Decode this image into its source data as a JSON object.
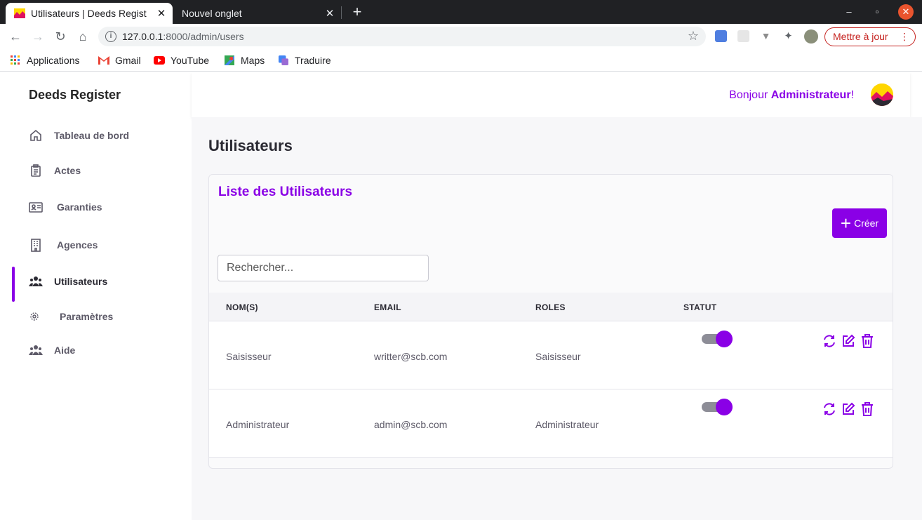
{
  "browser": {
    "tabs": [
      {
        "title": "Utilisateurs | Deeds Regist",
        "active": true
      },
      {
        "title": "Nouvel onglet",
        "active": false
      }
    ],
    "url_host": "127.0.0.1",
    "url_rest": ":8000/admin/users",
    "update_label": "Mettre à jour",
    "bookmarks": [
      "Applications",
      "Gmail",
      "YouTube",
      "Maps",
      "Traduire"
    ]
  },
  "sidebar": {
    "brand": "Deeds Register",
    "items": [
      {
        "label": "Tableau de bord",
        "icon": "home-icon"
      },
      {
        "label": "Actes",
        "icon": "clipboard-icon"
      },
      {
        "label": "Garanties",
        "icon": "id-card-icon"
      },
      {
        "label": "Agences",
        "icon": "building-icon"
      },
      {
        "label": "Utilisateurs",
        "icon": "users-icon",
        "active": true
      },
      {
        "label": "Paramètres",
        "icon": "gear-icon"
      },
      {
        "label": "Aide",
        "icon": "users-icon"
      }
    ]
  },
  "header": {
    "greeting_prefix": "Bonjour ",
    "greeting_name": "Administrateur",
    "greeting_suffix": "!"
  },
  "main": {
    "page_title": "Utilisateurs",
    "card_title": "Liste des Utilisateurs",
    "create_label": "Créer",
    "search_placeholder": "Rechercher...",
    "columns": [
      "NOM(S)",
      "EMAIL",
      "ROLES",
      "STATUT"
    ],
    "rows": [
      {
        "name": "Saisisseur",
        "email": "writter@scb.com",
        "role": "Saisisseur",
        "status": true
      },
      {
        "name": "Administrateur",
        "email": "admin@scb.com",
        "role": "Administrateur",
        "status": true
      }
    ]
  },
  "colors": {
    "accent": "#8a00e6",
    "toggle_track": "#8d8d97"
  }
}
